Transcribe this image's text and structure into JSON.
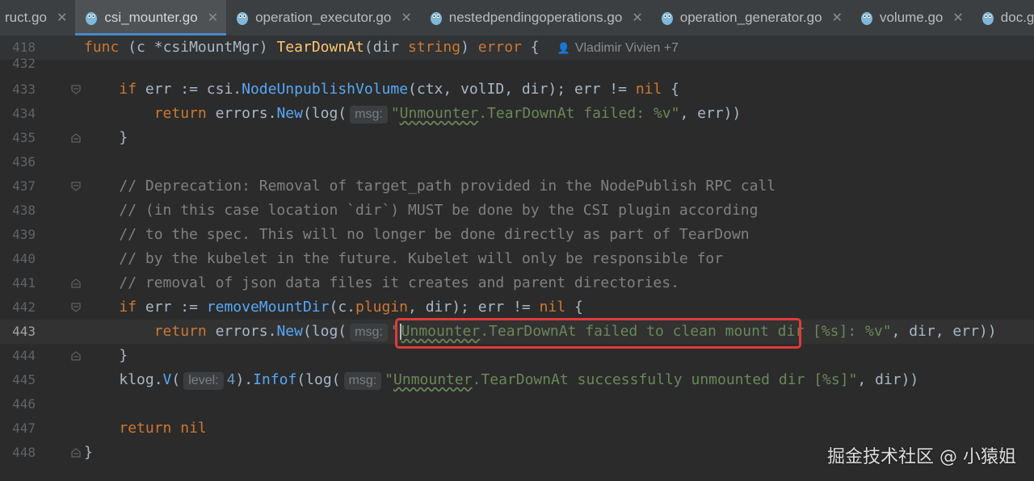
{
  "tabs": [
    {
      "label": "ruct.go",
      "active": false
    },
    {
      "label": "csi_mounter.go",
      "active": true
    },
    {
      "label": "operation_executor.go",
      "active": false
    },
    {
      "label": "nestedpendingoperations.go",
      "active": false
    },
    {
      "label": "operation_generator.go",
      "active": false
    },
    {
      "label": "volume.go",
      "active": false
    },
    {
      "label": "doc.go",
      "active": false
    }
  ],
  "sticky": {
    "line": "418",
    "func_kw": "func",
    "recv_open": " (",
    "recv_name": "c",
    "recv_type": " *csiMountMgr",
    "recv_close": ") ",
    "func_name": "TearDownAt",
    "param_open": "(",
    "param_name": "dir",
    "param_type": " string",
    "param_close": ") ",
    "ret_type": "error",
    "brace": " {",
    "author": "Vladimir Vivien +7"
  },
  "lines": {
    "l432": "432",
    "l433": "433",
    "l434": "434",
    "l435": "435",
    "l436": "436",
    "l437": "437",
    "l438": "438",
    "l439": "439",
    "l440": "440",
    "l441": "441",
    "l442": "442",
    "l443": "443",
    "l444": "444",
    "l445": "445",
    "l446": "446",
    "l447": "447",
    "l448": "448"
  },
  "code": {
    "if": "if",
    "err": "err",
    "assign": " := ",
    "csi_pkg": "csi.",
    "node_unpublish": "NodeUnpublishVolume",
    "unpublish_args": "(ctx, volID, dir); ",
    "neq": " != ",
    "nil": "nil",
    "open_brace": " {",
    "return": "return",
    "errors_pkg": " errors.",
    "new": "New",
    "log_open": "(log(",
    "hint_msg": "msg:",
    "str_unmounter": "Unmounter",
    "str434_rest": ".TearDownAt failed: %v\"",
    "args434": ", err))",
    "close_brace": "}",
    "c437": "// Deprecation: Removal of target_path provided in the NodePublish RPC call",
    "c438": "// (in this case location `dir`) MUST be done by the CSI plugin according",
    "c439": "// to the spec. This will no longer be done directly as part of TearDown",
    "c440": "// by the kubelet in the future. Kubelet will only be responsible for",
    "c441": "// removal of json data files it creates and parent directories.",
    "remove_mount_dir": "removeMountDir",
    "remove_args_open": "(c.",
    "plugin": "plugin",
    "remove_args_close": ", dir); ",
    "quote_open": "\"",
    "str443_rest": ".TearDownAt failed to clean mount dir [%s]: %v\"",
    "args443": ", dir, err))",
    "klog": "klog.",
    "v_fn": "V",
    "paren_open": "(",
    "hint_level": "level:",
    "level_val": "4",
    "infof_open": ").",
    "infof": "Infof",
    "log_open2": "(log(",
    "str445_rest": ".TearDownAt successfully unmounted dir [%s]\"",
    "args445": ", dir))"
  },
  "watermark": "掘金技术社区 @ 小猿姐",
  "colors": {
    "background": "#2b2b2b",
    "keyword": "#cc7832",
    "string": "#6a8759",
    "comment": "#808080",
    "function": "#ffc66d",
    "highlight_box": "#e03a3a"
  }
}
